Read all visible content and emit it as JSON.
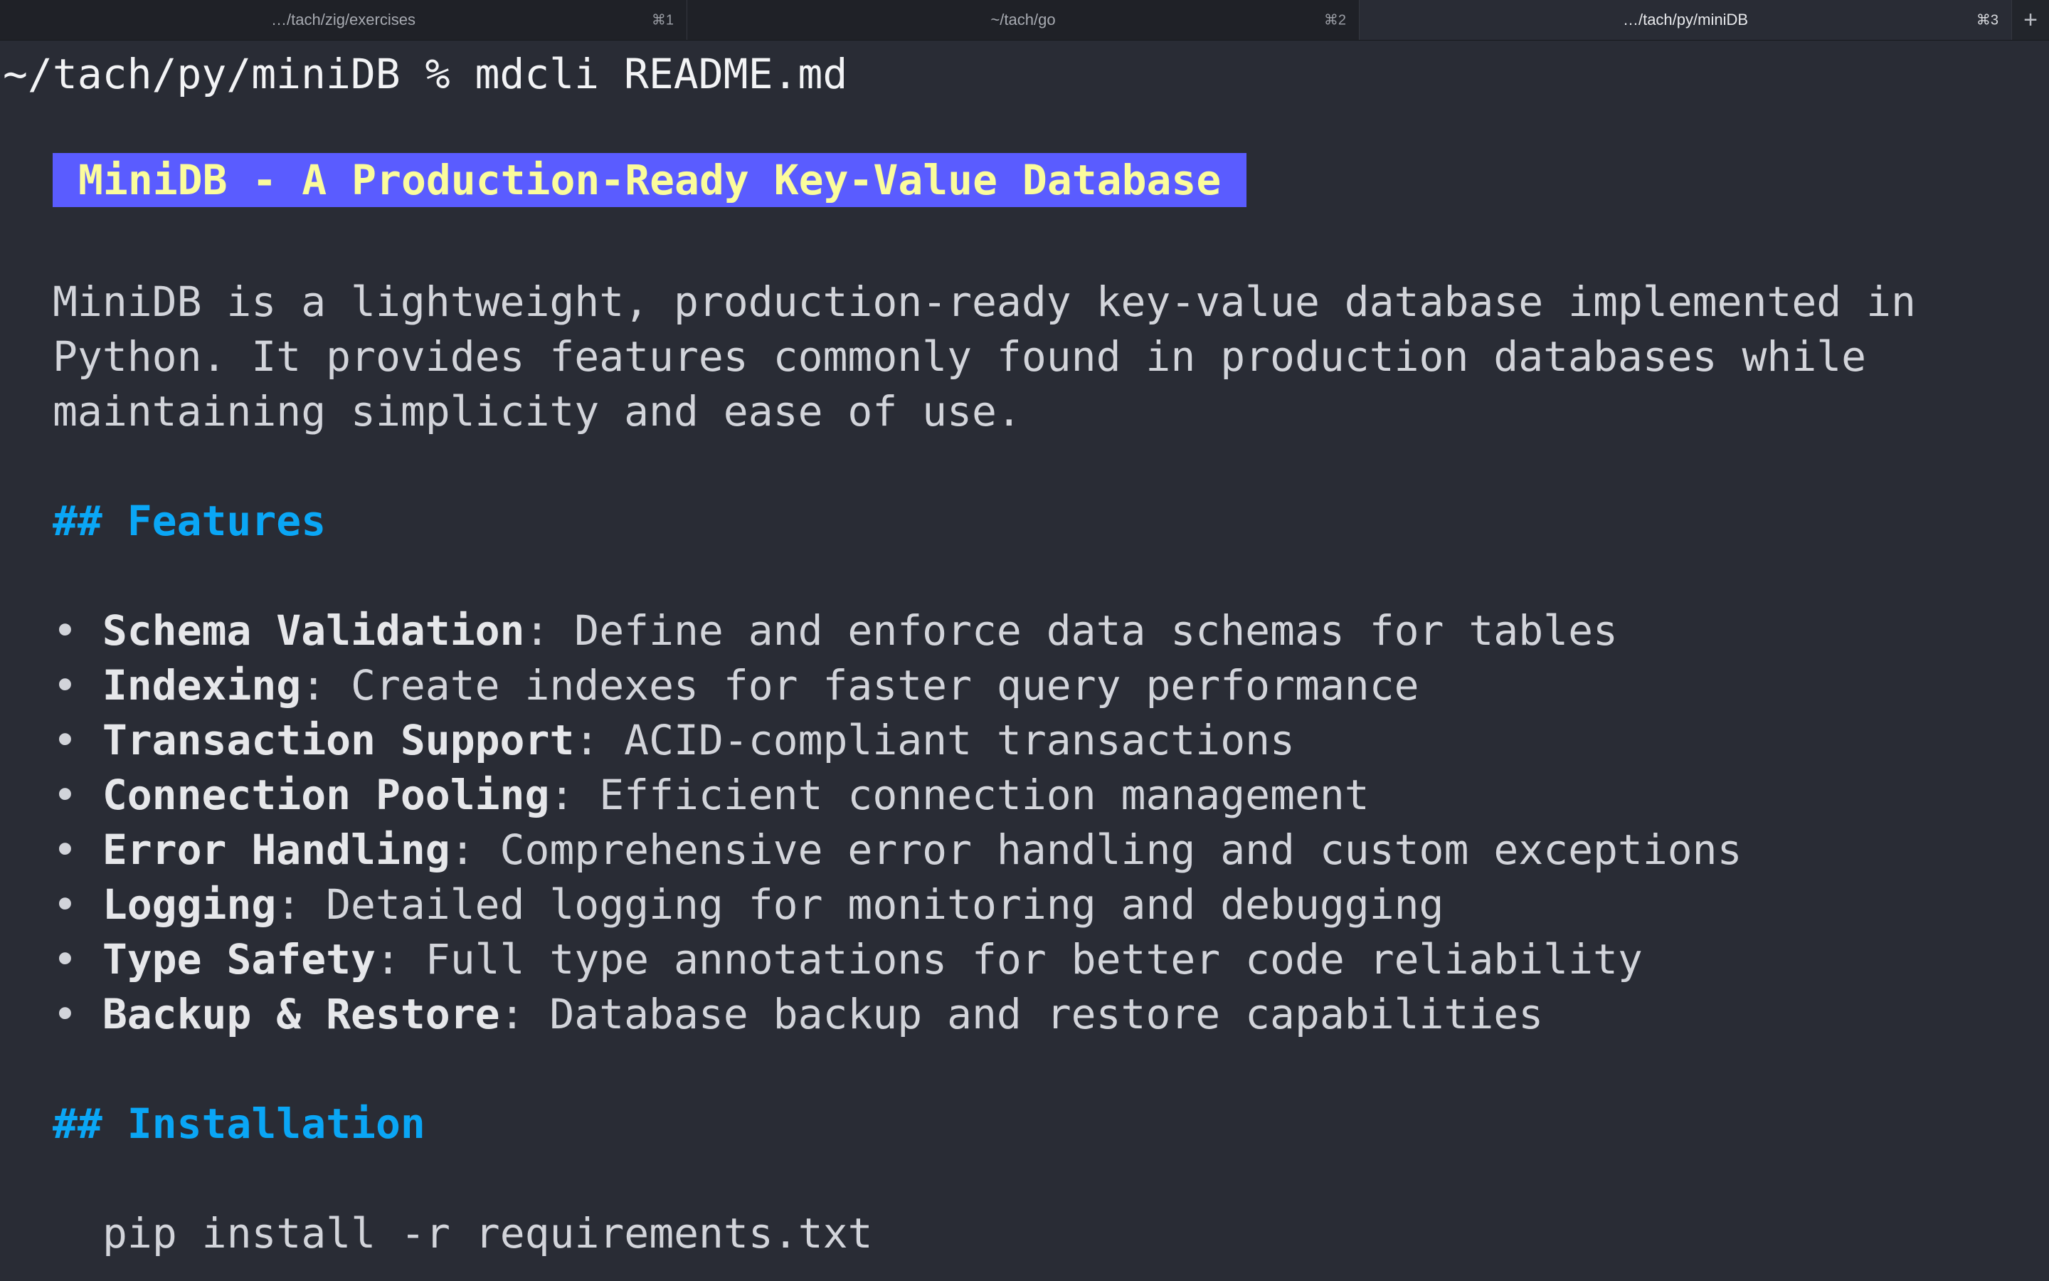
{
  "tabs": [
    {
      "label": "…/tach/zig/exercises",
      "shortcut": "⌘1"
    },
    {
      "label": "~/tach/go",
      "shortcut": "⌘2"
    },
    {
      "label": "…/tach/py/miniDB",
      "shortcut": "⌘3"
    }
  ],
  "new_tab_label": "+",
  "terminal": {
    "prompt": "~/tach/py/miniDB % mdcli README.md",
    "title": "MiniDB - A Production-Ready Key-Value Database",
    "intro_lines": [
      "MiniDB is a lightweight, production-ready key-value database implemented in",
      "Python. It provides features commonly found in production databases while",
      "maintaining simplicity and ease of use."
    ],
    "features_heading": "## Features",
    "bullet_char": "• ",
    "features": [
      {
        "name": "Schema Validation",
        "desc": ": Define and enforce data schemas for tables"
      },
      {
        "name": "Indexing",
        "desc": ": Create indexes for faster query performance"
      },
      {
        "name": "Transaction Support",
        "desc": ": ACID-compliant transactions"
      },
      {
        "name": "Connection Pooling",
        "desc": ": Efficient connection management"
      },
      {
        "name": "Error Handling",
        "desc": ": Comprehensive error handling and custom exceptions"
      },
      {
        "name": "Logging",
        "desc": ": Detailed logging for monitoring and debugging"
      },
      {
        "name": "Type Safety",
        "desc": ": Full type annotations for better code reliability"
      },
      {
        "name": "Backup & Restore",
        "desc": ": Database backup and restore capabilities"
      }
    ],
    "installation_heading": "## Installation",
    "install_command": "pip install -r requirements.txt"
  },
  "colors": {
    "background": "#292c35",
    "title_bg": "#5a5cff",
    "title_fg": "#fbfc9c",
    "heading": "#0aa6f5"
  }
}
